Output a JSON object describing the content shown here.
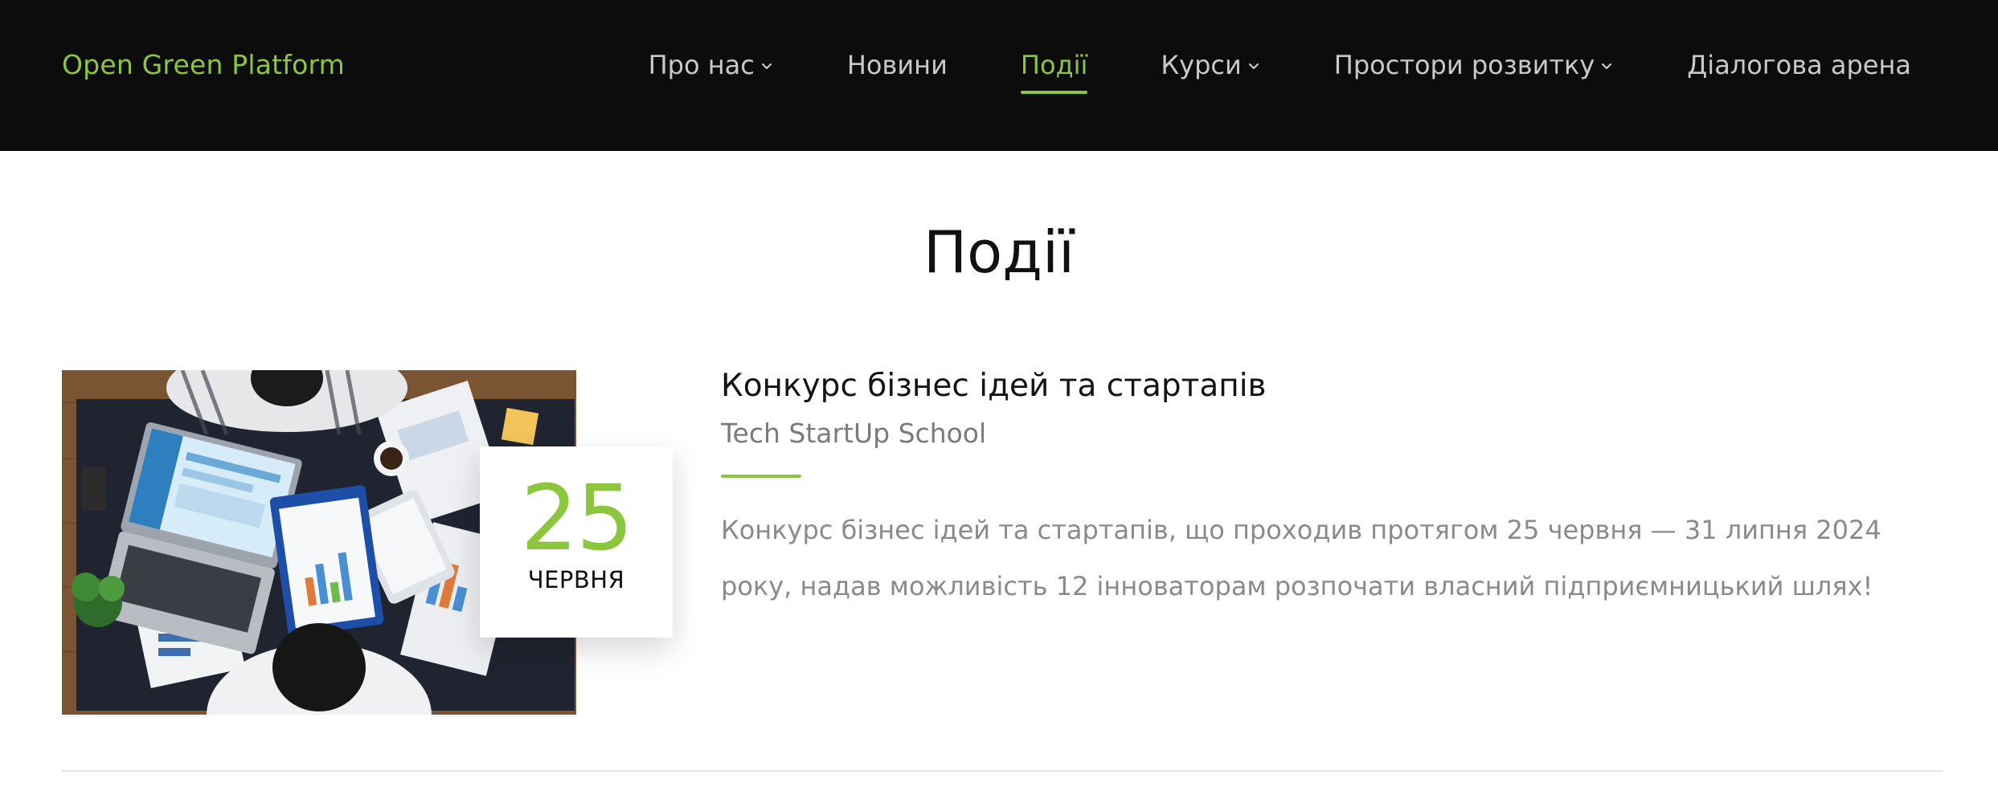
{
  "header": {
    "brand": "Open Green Platform",
    "nav": [
      {
        "label": "Про нас",
        "has_dropdown": true,
        "active": false
      },
      {
        "label": "Новини",
        "has_dropdown": false,
        "active": false
      },
      {
        "label": "Події",
        "has_dropdown": false,
        "active": true
      },
      {
        "label": "Курси",
        "has_dropdown": true,
        "active": false
      },
      {
        "label": "Простори розвитку",
        "has_dropdown": true,
        "active": false
      },
      {
        "label": "Діалогова арена",
        "has_dropdown": false,
        "active": false
      }
    ]
  },
  "page": {
    "title": "Події"
  },
  "events": [
    {
      "image": "business-meeting-photo",
      "date_day": "25",
      "date_month": "ЧЕРВНЯ",
      "title": "Конкурс бізнес ідей та стартапів",
      "organizer": "Tech StartUp School",
      "description": "Конкурс бізнес ідей та стартапів, що проходив протягом 25 червня — 31 липня 2024 року, надав можливість 12 інноваторам розпочати власний підприємницький шлях!"
    }
  ],
  "colors": {
    "accent": "#8cc63f",
    "header_bg": "#0c0c0c",
    "nav_text": "#c9c9c9",
    "title_text": "#111111",
    "muted_text": "#8a8a8a"
  },
  "icons": {
    "dropdown": "chevron-down-icon"
  }
}
